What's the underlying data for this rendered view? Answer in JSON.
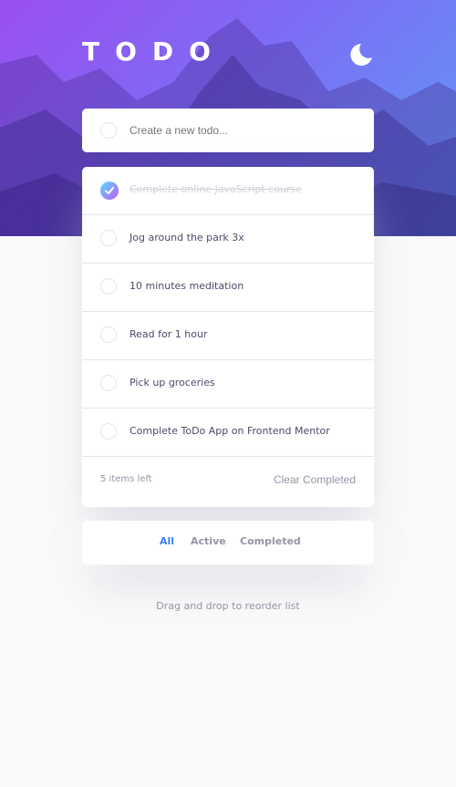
{
  "header": {
    "title": "TODO",
    "theme_icon": "moon-icon"
  },
  "new_todo": {
    "placeholder": "Create a new todo..."
  },
  "todos": [
    {
      "text": "Complete online JavaScript course",
      "completed": true
    },
    {
      "text": "Jog around the park 3x",
      "completed": false
    },
    {
      "text": "10 minutes meditation",
      "completed": false
    },
    {
      "text": "Read for 1 hour",
      "completed": false
    },
    {
      "text": "Pick up groceries",
      "completed": false
    },
    {
      "text": "Complete ToDo App on Frontend Mentor",
      "completed": false
    }
  ],
  "list_footer": {
    "items_left": "5 items left",
    "clear_label": "Clear Completed"
  },
  "filters": {
    "all": "All",
    "active": "Active",
    "completed": "Completed",
    "selected": "All"
  },
  "hint": "Drag and drop to reorder list",
  "colors": {
    "accent": "#3a7cfd",
    "gradient_start": "#55ddff",
    "gradient_end": "#c058f3"
  }
}
